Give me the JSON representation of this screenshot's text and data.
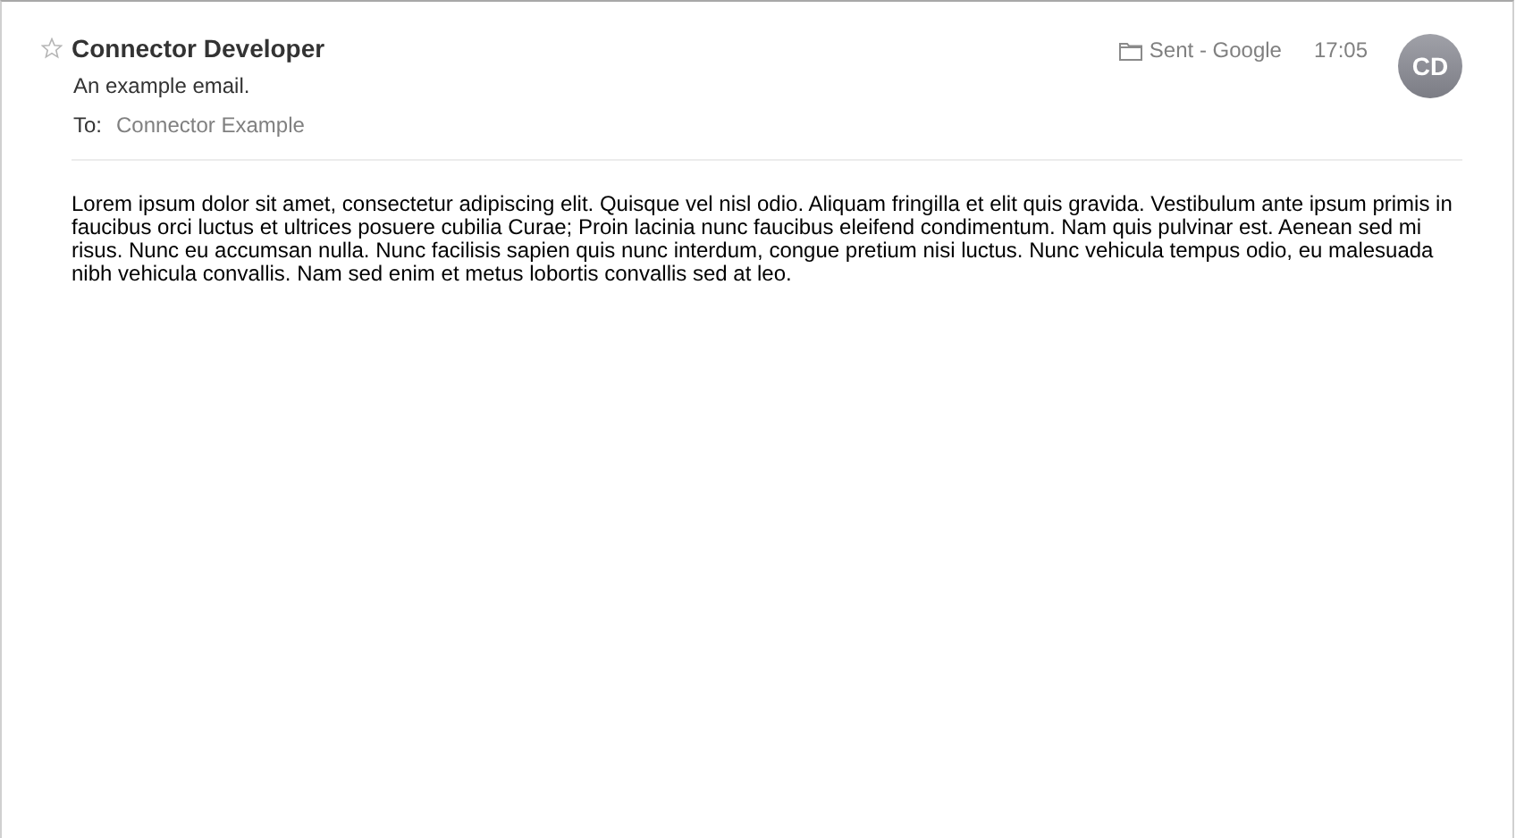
{
  "message": {
    "sender": "Connector Developer",
    "starred": false,
    "subject": "An example email.",
    "to_label": "To:",
    "to": "Connector Example",
    "mailbox": "Sent - Google",
    "time": "17:05",
    "avatar_initials": "CD",
    "body": "Lorem ipsum dolor sit amet, consectetur adipiscing elit. Quisque vel nisl odio. Aliquam fringilla et elit quis gravida. Vestibulum ante ipsum primis in faucibus orci luctus et ultrices posuere cubilia Curae; Proin lacinia nunc faucibus eleifend condimentum. Nam quis pulvinar est. Aenean sed mi risus. Nunc eu accumsan nulla. Nunc facilisis sapien quis nunc interdum, congue pretium nisi luctus. Nunc vehicula tempus odio, eu malesuada nibh vehicula convallis. Nam sed enim et metus lobortis convallis sed at leo."
  }
}
